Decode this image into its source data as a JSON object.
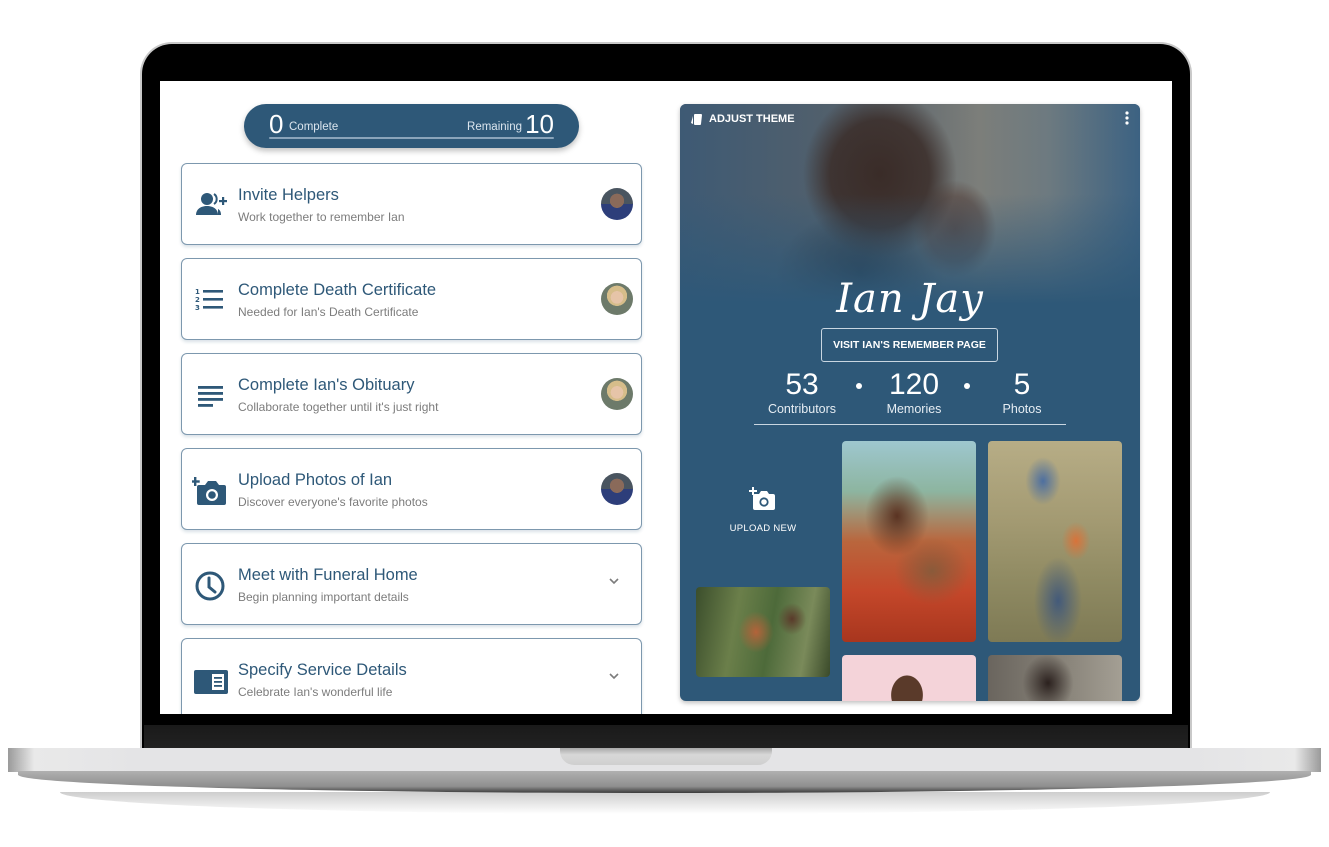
{
  "progress": {
    "complete_count": "0",
    "complete_label": "Complete",
    "remaining_label": "Remaining",
    "remaining_count": "10",
    "fraction_complete": 0
  },
  "tasks": [
    {
      "title": "Invite Helpers",
      "subtitle": "Work together to remember Ian",
      "icon": "invite-users-icon",
      "trailing": "avatar"
    },
    {
      "title": "Complete Death Certificate",
      "subtitle": "Needed for Ian's Death Certificate",
      "icon": "numbered-list-icon",
      "trailing": "avatar"
    },
    {
      "title": "Complete Ian's Obituary",
      "subtitle": "Collaborate together until it's just right",
      "icon": "text-lines-icon",
      "trailing": "avatar"
    },
    {
      "title": "Upload Photos of Ian",
      "subtitle": "Discover everyone's favorite photos",
      "icon": "add-photo-icon",
      "trailing": "avatar"
    },
    {
      "title": "Meet with Funeral Home",
      "subtitle": "Begin planning important details",
      "icon": "clock-icon",
      "trailing": "chevron"
    },
    {
      "title": "Specify Service Details",
      "subtitle": "Celebrate Ian's wonderful life",
      "icon": "program-icon",
      "trailing": "chevron"
    }
  ],
  "memorial": {
    "adjust_theme_label": "ADJUST THEME",
    "name": "Ian Jay",
    "visit_button_label": "VISIT IAN'S REMEMBER PAGE",
    "stats": [
      {
        "value": "53",
        "label": "Contributors"
      },
      {
        "value": "120",
        "label": "Memories"
      },
      {
        "value": "5",
        "label": "Photos"
      }
    ],
    "upload_label": "UPLOAD NEW",
    "accent_color": "#2e5878"
  }
}
